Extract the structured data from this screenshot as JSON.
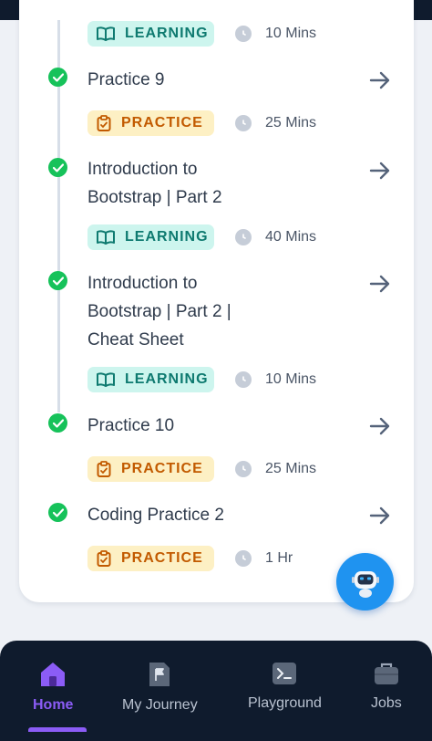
{
  "colors": {
    "accent_green": "#16c25a",
    "learning_bg": "#cdf5ee",
    "learning_text": "#0e7a70",
    "practice_bg": "#fdf0c4",
    "practice_text": "#c25a00",
    "nav_bg": "#0f1b2d",
    "nav_active": "#8b5cf6",
    "bot_bg": "#1f93f0"
  },
  "top_partial": {
    "badge": "LEARNING",
    "duration": "10 Mins"
  },
  "items": [
    {
      "title": "Practice 9",
      "badge": "PRACTICE",
      "duration": "25 Mins",
      "completed": true
    },
    {
      "title_line1": "Introduction to",
      "title_line2": "Bootstrap | Part 2",
      "badge": "LEARNING",
      "duration": "40 Mins",
      "completed": true
    },
    {
      "title_line1": "Introduction to",
      "title_line2": "Bootstrap | Part 2 |",
      "title_line3": "Cheat Sheet",
      "badge": "LEARNING",
      "duration": "10 Mins",
      "completed": true
    },
    {
      "title": "Practice 10",
      "badge": "PRACTICE",
      "duration": "25 Mins",
      "completed": true
    },
    {
      "title": "Coding Practice 2",
      "badge": "PRACTICE",
      "duration": "1 Hr",
      "completed": true
    }
  ],
  "nav": {
    "items": [
      {
        "label": "Home",
        "icon": "home-icon",
        "active": true
      },
      {
        "label": "My Journey",
        "icon": "flag-document-icon",
        "active": false
      },
      {
        "label": "Playground",
        "icon": "terminal-icon",
        "active": false
      },
      {
        "label": "Jobs",
        "icon": "briefcase-icon",
        "active": false
      }
    ]
  },
  "assistant": {
    "icon": "robot-icon"
  }
}
